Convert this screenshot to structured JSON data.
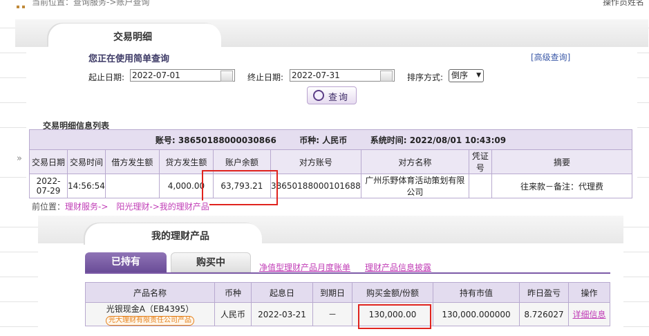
{
  "top": {
    "breadcrumb": "当前位置：查询服务->账户查询",
    "right_text": "操作员姓名"
  },
  "panel1": {
    "tab_title": "交易明细",
    "simple_label": "您正在使用简单查询",
    "advanced_link": "[高级查询]",
    "start_label": "起止日期:",
    "start_value": "2022-07-01",
    "end_label": "终止日期:",
    "end_value": "2022-07-31",
    "sort_label": "排序方式:",
    "sort_value": "倒序",
    "query_button": "查询",
    "list_title": "交易明细信息列表",
    "acct_label": "账号:",
    "acct_no": "38650188000030866",
    "currency_label": "币种:",
    "currency": "人民币",
    "time_label": "系统时间:",
    "time": "2022/08/01 10:43:09",
    "columns": [
      "交易日期",
      "交易时间",
      "借方发生额",
      "贷方发生额",
      "账户余额",
      "对方账号",
      "对方名称",
      "凭证号",
      "摘要"
    ],
    "row": {
      "date": "2022-07-29",
      "time": "14:56:54",
      "debit": "",
      "credit": "4,000.00",
      "balance": "63,793.21",
      "counter_account": "38650188000101688",
      "counter_name": "广州乐野体育活动策划有限公司",
      "voucher": "",
      "summary": "往来款－备注：代理费"
    }
  },
  "panel2": {
    "breadcrumb_prefix": "前位置：",
    "breadcrumb_path": "理财服务->　阳光理财->我的理财产品",
    "tab_title": "我的理财产品",
    "tab_held": "已持有",
    "tab_buy": "购买中",
    "link_monthly": "净值型理财产品月度账单",
    "link_disclosure": "理财产品信息披露",
    "columns": [
      "产品名称",
      "币种",
      "起息日",
      "到期日",
      "购买金额/份额",
      "持有市值",
      "昨日盈亏",
      "操作"
    ],
    "row": {
      "product_name": "光银现金A（EB4395）",
      "product_badge": "光大理财有限责任公司产品",
      "currency": "人民币",
      "start_date": "2022-03-21",
      "end_date": "－",
      "amount": "130,000.00",
      "market_value": "130,000.000000",
      "pnl": "8.726027",
      "action": "详细信息"
    }
  },
  "colors": {
    "accent": "#7c5aa7",
    "highlight_box": "#e0231e",
    "link": "#c03cb6"
  }
}
